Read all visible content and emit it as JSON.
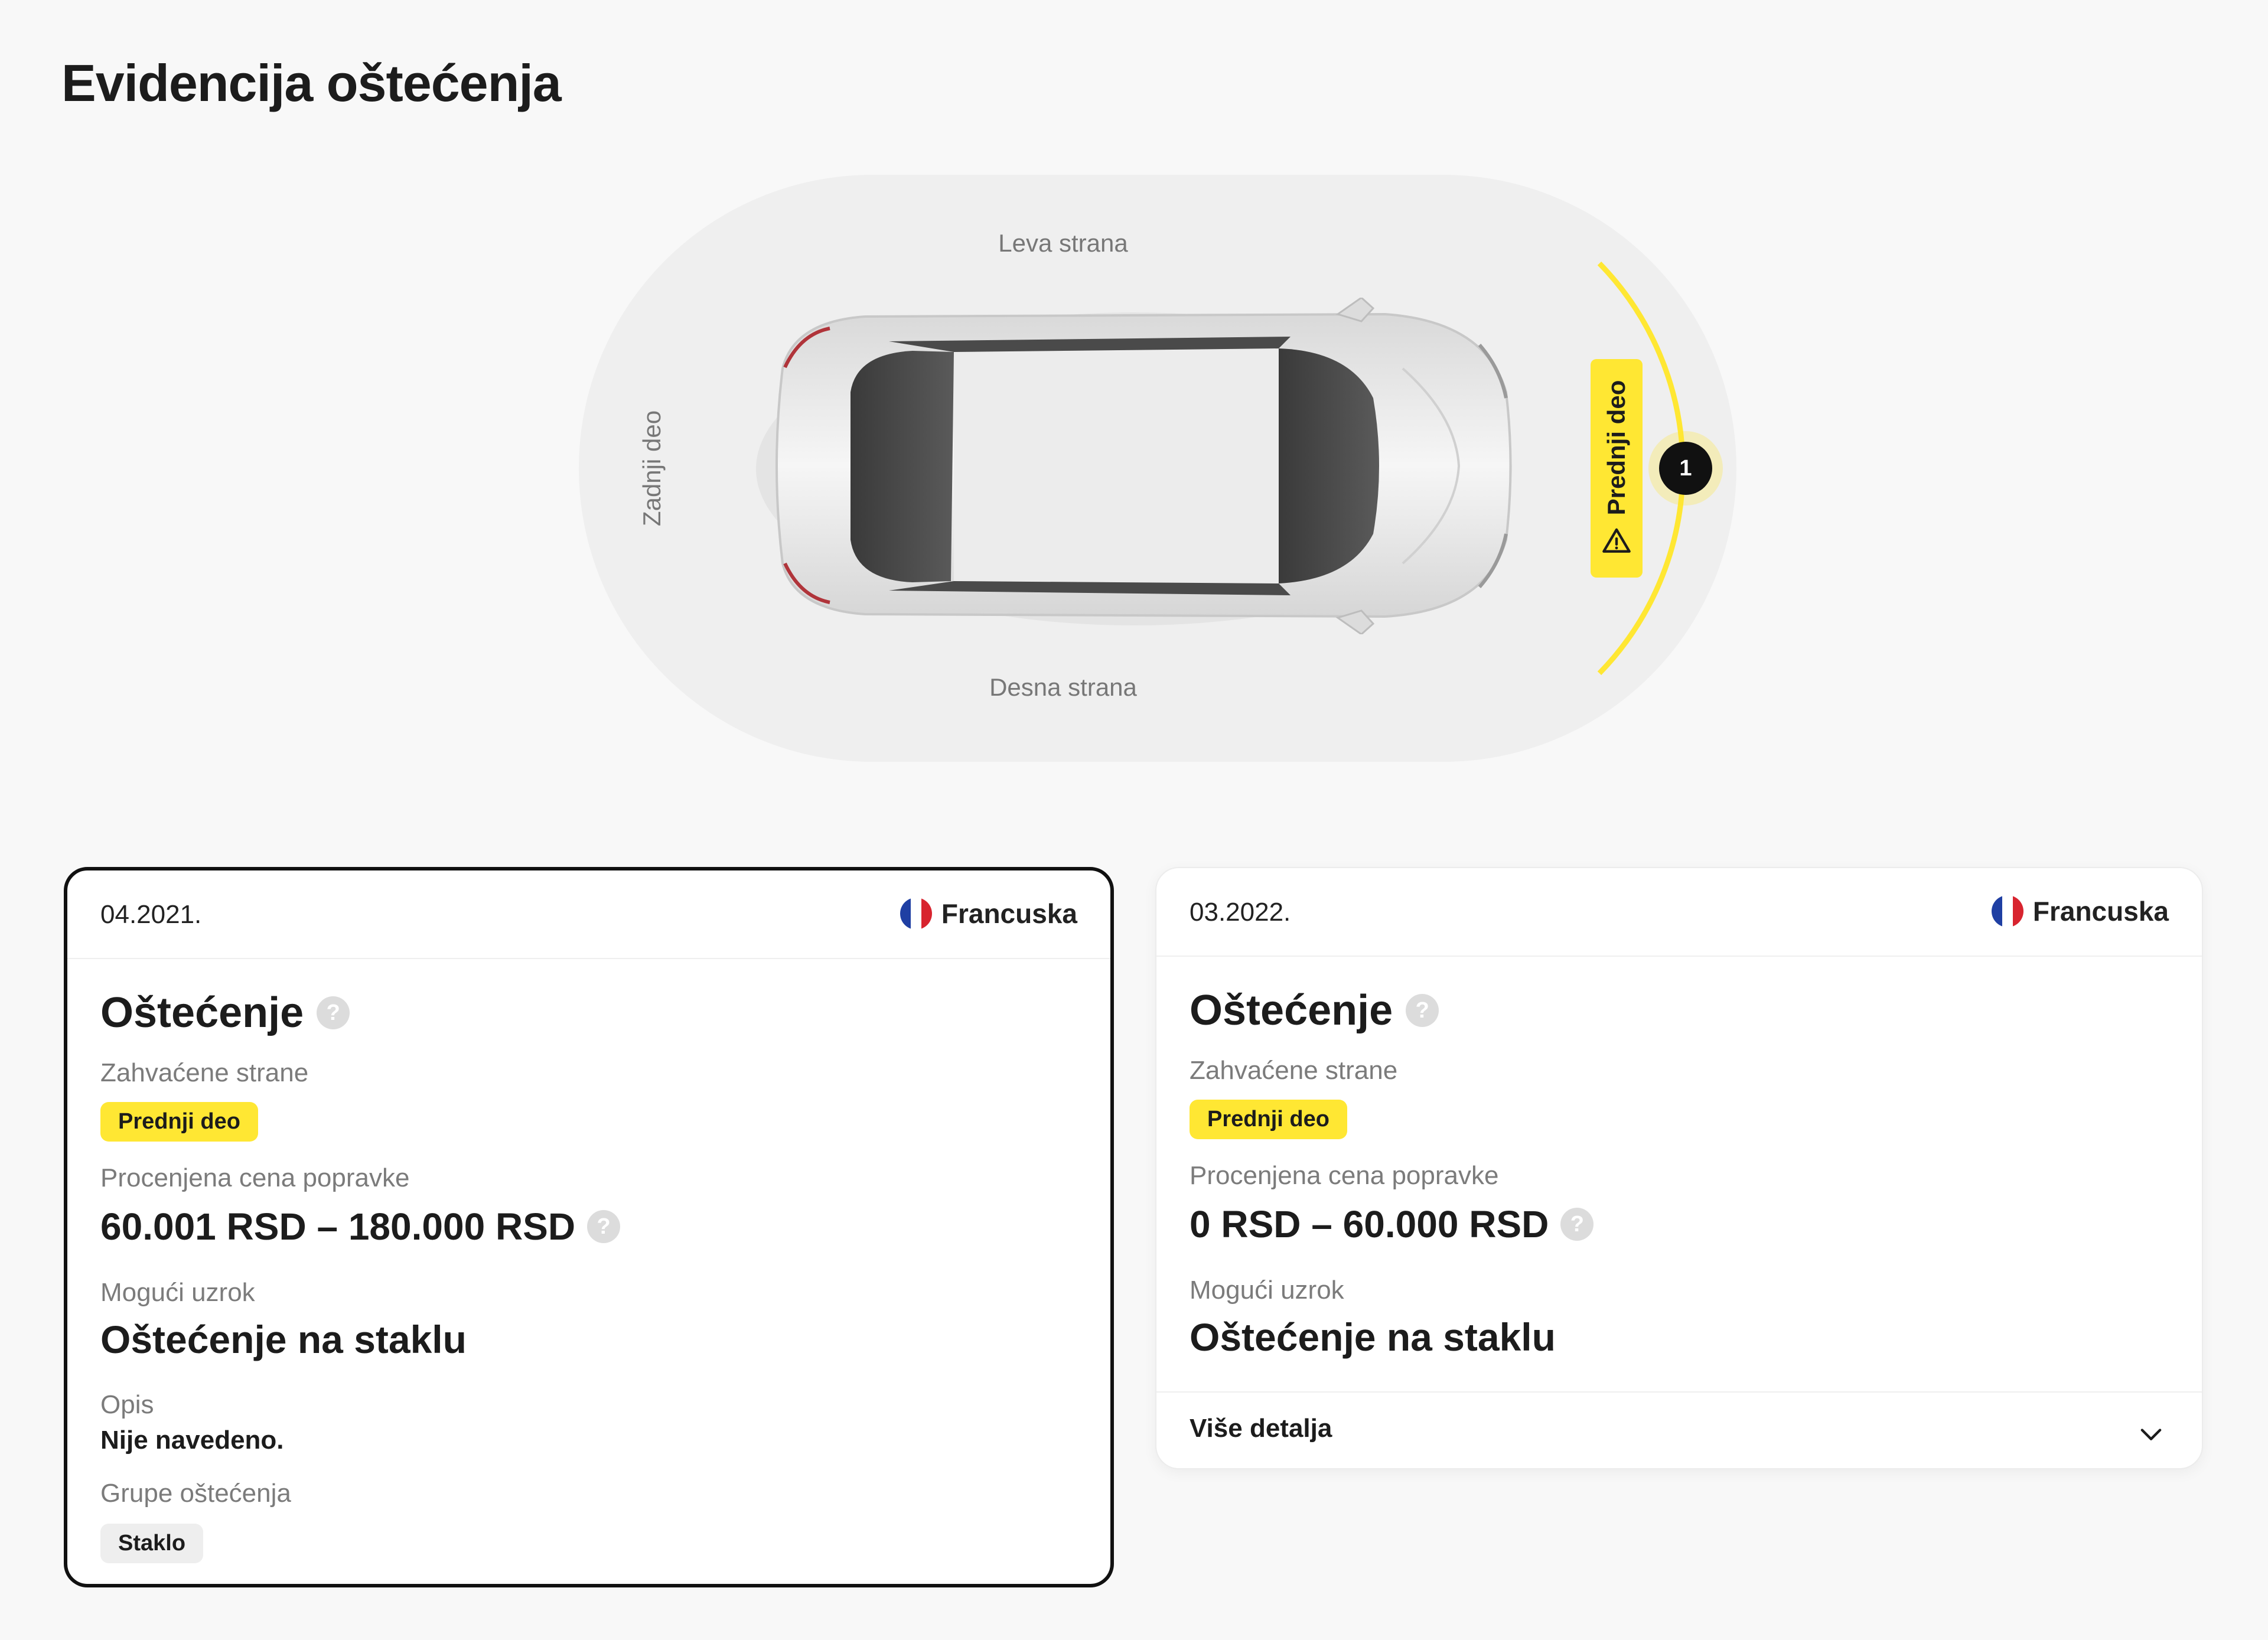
{
  "page": {
    "title": "Evidencija oštećenja"
  },
  "diagram": {
    "left_side": "Leva strana",
    "right_side": "Desna strana",
    "rear": "Zadnji deo",
    "front": "Prednji deo",
    "marker_count": "1",
    "warning_icon": "warning-triangle-icon",
    "highlight_color": "#ffe733"
  },
  "cards": [
    {
      "date": "04.2021.",
      "country": "Francuska",
      "country_flag": "france-flag-icon",
      "title": "Oštećenje",
      "sides_label": "Zahvaćene strane",
      "side_badge": "Prednji deo",
      "price_label": "Procenjena cena popravke",
      "price": "60.001 RSD – 180.000 RSD",
      "cause_label": "Mogući uzrok",
      "cause": "Oštećenje na staklu",
      "desc_label": "Opis",
      "desc": "Nije navedeno.",
      "groups_label": "Grupe oštećenja",
      "group_badge": "Staklo",
      "selected": true
    },
    {
      "date": "03.2022.",
      "country": "Francuska",
      "country_flag": "france-flag-icon",
      "title": "Oštećenje",
      "sides_label": "Zahvaćene strane",
      "side_badge": "Prednji deo",
      "price_label": "Procenjena cena popravke",
      "price": "0 RSD – 60.000 RSD",
      "cause_label": "Mogući uzrok",
      "cause": "Oštećenje na staklu",
      "more_label": "Više detalja",
      "selected": false
    }
  ]
}
